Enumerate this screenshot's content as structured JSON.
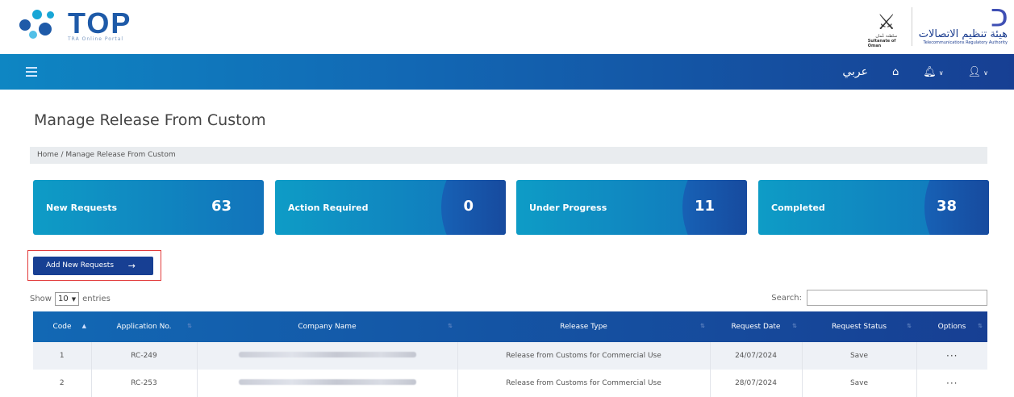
{
  "header": {
    "brand_title": "TOP",
    "brand_subtitle": "TRA Online Portal",
    "emblem_caption_ar": "سلطنة عُمان",
    "emblem_caption_en": "Sultanate of Oman",
    "authority_ar": "هيئة تنظيم الاتصالات",
    "authority_en": "Telecommunications Regulatory Authority"
  },
  "navbar": {
    "language": "عربي",
    "home_icon": "home-icon",
    "bell_icon": "bell-icon",
    "user_icon": "user-icon"
  },
  "page": {
    "title": "Manage Release From Custom",
    "breadcrumb": "Home / Manage Release From Custom"
  },
  "stats": [
    {
      "label": "New Requests",
      "value": "63"
    },
    {
      "label": "Action Required",
      "value": "0"
    },
    {
      "label": "Under Progress",
      "value": "11"
    },
    {
      "label": "Completed",
      "value": "38"
    }
  ],
  "actions": {
    "add_label": "Add New Requests",
    "add_arrow": "→"
  },
  "controls": {
    "show_label": "Show",
    "entries_value": "10",
    "entries_label": "entries",
    "search_label": "Search:"
  },
  "table": {
    "headers": [
      "Code",
      "Application No.",
      "Company Name",
      "Release Type",
      "Request Date",
      "Request Status",
      "Options"
    ],
    "rows": [
      {
        "code": "1",
        "app": "RC-249",
        "company": "",
        "type": "Release from Customs for Commercial Use",
        "date": "24/07/2024",
        "status": "Save",
        "options": "···"
      },
      {
        "code": "2",
        "app": "RC-253",
        "company": "",
        "type": "Release from Customs for Commercial Use",
        "date": "28/07/2024",
        "status": "Save",
        "options": "···"
      }
    ]
  },
  "colors": {
    "accent": "#173f93",
    "nav_start": "#0e86c3",
    "card_start": "#0e9cc6",
    "highlight": "#e23b3b"
  }
}
